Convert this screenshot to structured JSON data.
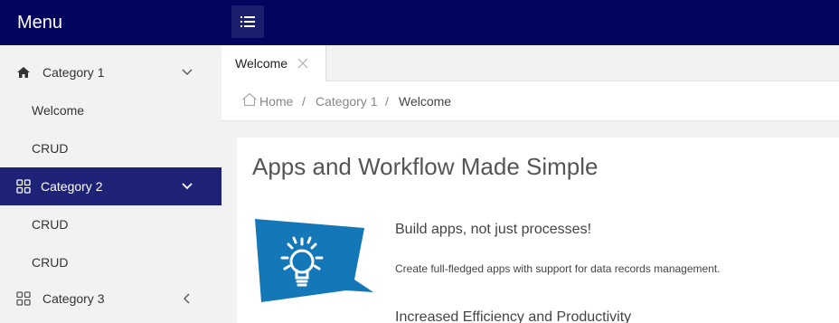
{
  "header": {
    "brand": "Menu",
    "menu_toggle_icon": "hamburger-icon"
  },
  "sidebar": {
    "items": [
      {
        "label": "Category 1",
        "icon": "home-icon",
        "chevron": "chevron-down-icon",
        "level": 0
      },
      {
        "label": "Welcome",
        "level": 1
      },
      {
        "label": "CRUD",
        "level": 1
      },
      {
        "label": "Category 2",
        "icon": "grid-icon",
        "chevron": "chevron-down-icon",
        "level": 0,
        "active": true
      },
      {
        "label": "CRUD",
        "level": 1
      },
      {
        "label": "CRUD",
        "level": 1
      },
      {
        "label": "Category 3",
        "icon": "grid-icon",
        "chevron": "chevron-left-icon",
        "level": 0
      }
    ]
  },
  "tabs": [
    {
      "label": "Welcome",
      "closable": true
    }
  ],
  "breadcrumb": {
    "home": "Home",
    "sep": "/",
    "category": "Category 1",
    "current": "Welcome"
  },
  "main": {
    "title": "Apps and Workflow Made Simple",
    "features": [
      {
        "heading": "Build apps, not just processes!",
        "text": "Create full-fledged apps with support for data records management."
      },
      {
        "heading": "Increased Efficiency and Productivity"
      }
    ]
  },
  "colors": {
    "topbar": "#03045e",
    "active_nav": "#1e2378",
    "feature_blue": "#1478b8"
  }
}
